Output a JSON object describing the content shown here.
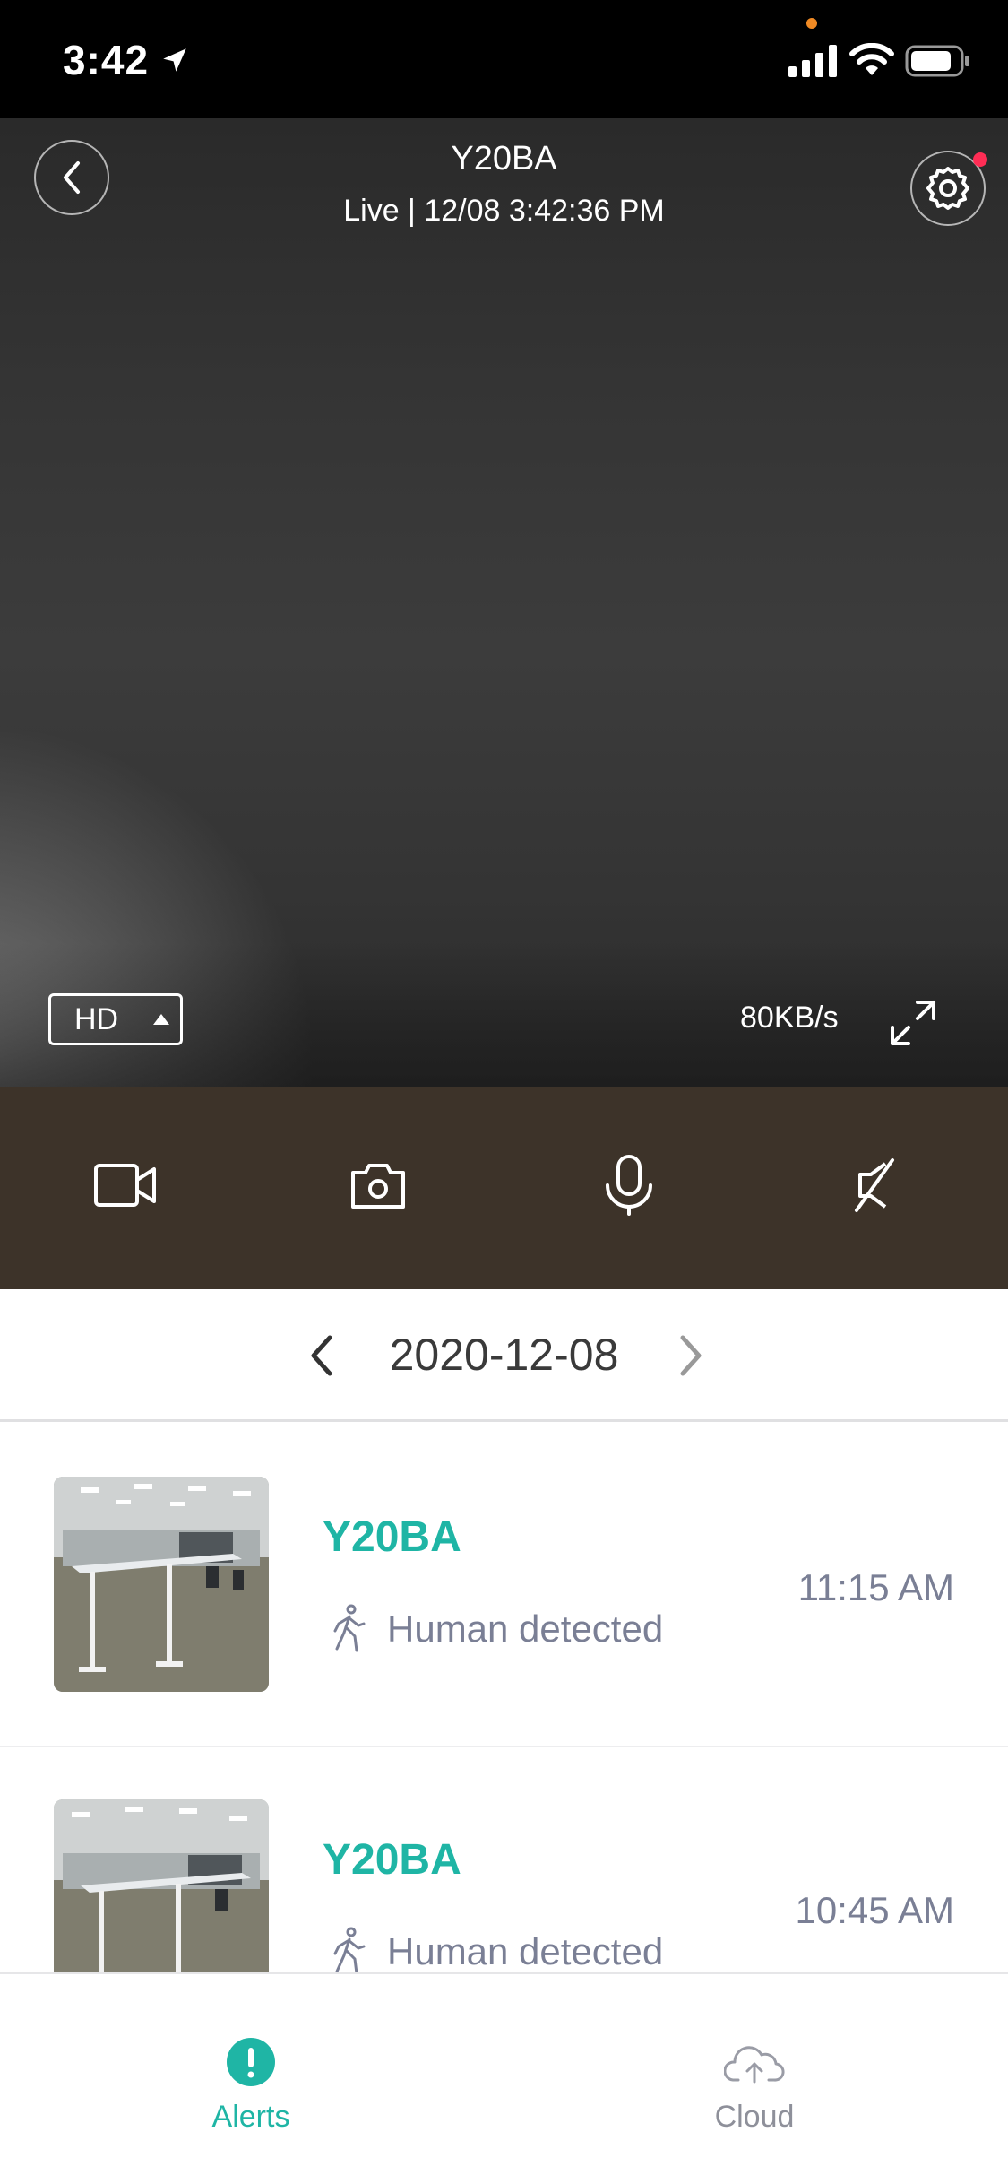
{
  "status_bar": {
    "time": "3:42"
  },
  "camera": {
    "title": "Y20BA",
    "subtitle": "Live | 12/08 3:42:36 PM",
    "quality": "HD",
    "bitrate": "80KB/s"
  },
  "controls": {
    "icons": [
      "record-video-icon",
      "snapshot-camera-icon",
      "microphone-icon",
      "mute-speaker-icon"
    ]
  },
  "date_nav": {
    "date": "2020-12-08"
  },
  "alerts": [
    {
      "device": "Y20BA",
      "type": "Human detected",
      "time": "11:15 AM"
    },
    {
      "device": "Y20BA",
      "type": "Human detected",
      "time": "10:45 AM"
    }
  ],
  "tabs": [
    {
      "label": "Alerts",
      "active": true
    },
    {
      "label": "Cloud",
      "active": false
    }
  ],
  "colors": {
    "accent": "#1fb5a5",
    "control_bar": "#3d3329",
    "secondary_text": "#7a7f95",
    "notification_dot": "#ff2d55"
  }
}
